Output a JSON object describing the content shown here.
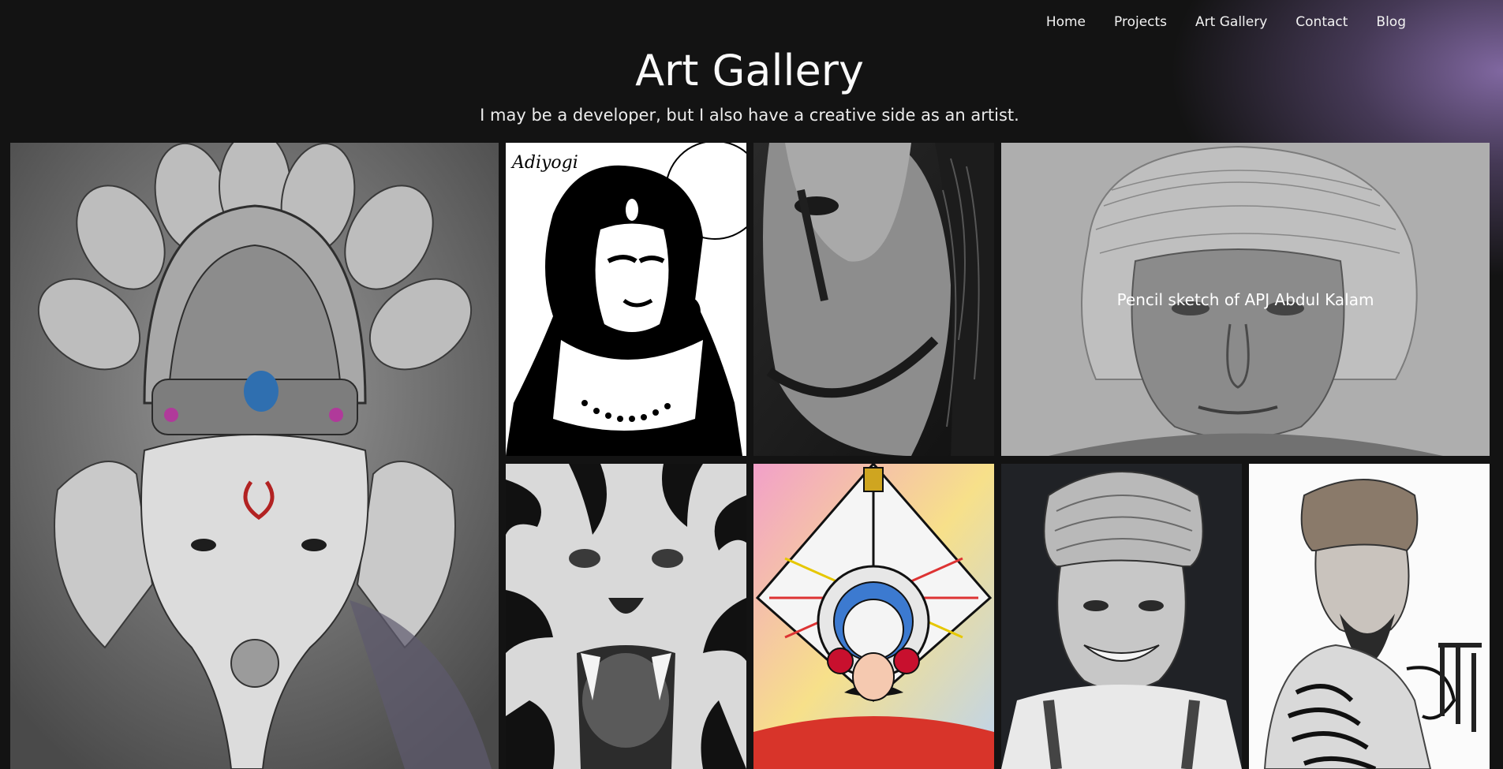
{
  "nav": {
    "items": [
      "Home",
      "Projects",
      "Art Gallery",
      "Contact",
      "Blog"
    ]
  },
  "header": {
    "title": "Art Gallery",
    "subtitle": "I may be a developer, but I also have a creative side as an artist."
  },
  "gallery": {
    "hover_caption": "Pencil sketch of APJ Abdul Kalam",
    "artwork_signature": "Adiyogi"
  },
  "colors": {
    "background": "#131313",
    "accent_glow": "#866ca8",
    "text": "#f2f2f2"
  }
}
